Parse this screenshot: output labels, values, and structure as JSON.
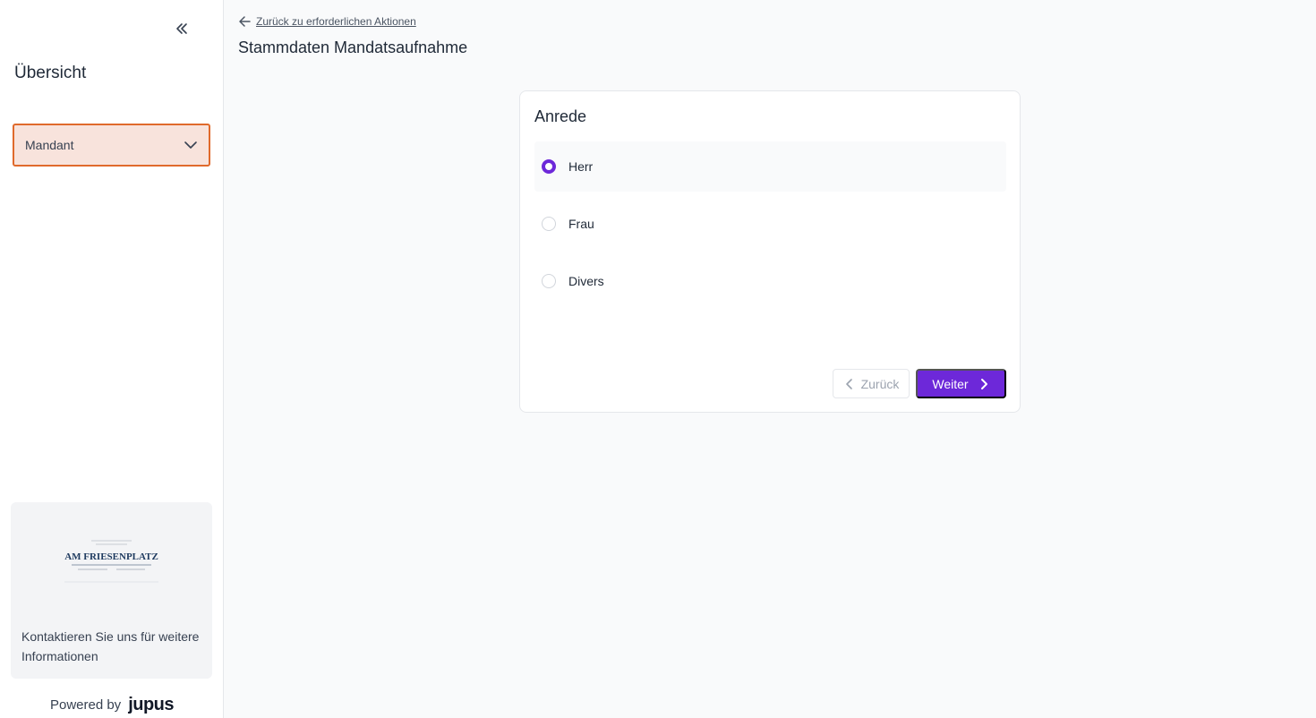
{
  "sidebar": {
    "title": "Übersicht",
    "selector": {
      "value": "Mandant"
    },
    "info_card": {
      "logo_text": "AM FRIESENPLATZ",
      "text": "Kontaktieren Sie uns für weitere Informationen"
    },
    "powered_by": "Powered by",
    "brand": "jupus"
  },
  "main": {
    "back_link": "Zurück zu erforderlichen Aktionen",
    "page_title": "Stammdaten Mandatsaufnahme",
    "card": {
      "title": "Anrede",
      "options": [
        {
          "label": "Herr",
          "selected": true
        },
        {
          "label": "Frau",
          "selected": false
        },
        {
          "label": "Divers",
          "selected": false
        }
      ],
      "back_button": "Zurück",
      "next_button": "Weiter"
    }
  },
  "colors": {
    "accent": "#6d28d9",
    "selector_border": "#e06a2c",
    "selector_bg": "#f8e3dc"
  },
  "icons": [
    "double-chevron-left-icon",
    "chevron-down-icon",
    "arrow-left-icon",
    "chevron-left-icon",
    "chevron-right-icon"
  ]
}
